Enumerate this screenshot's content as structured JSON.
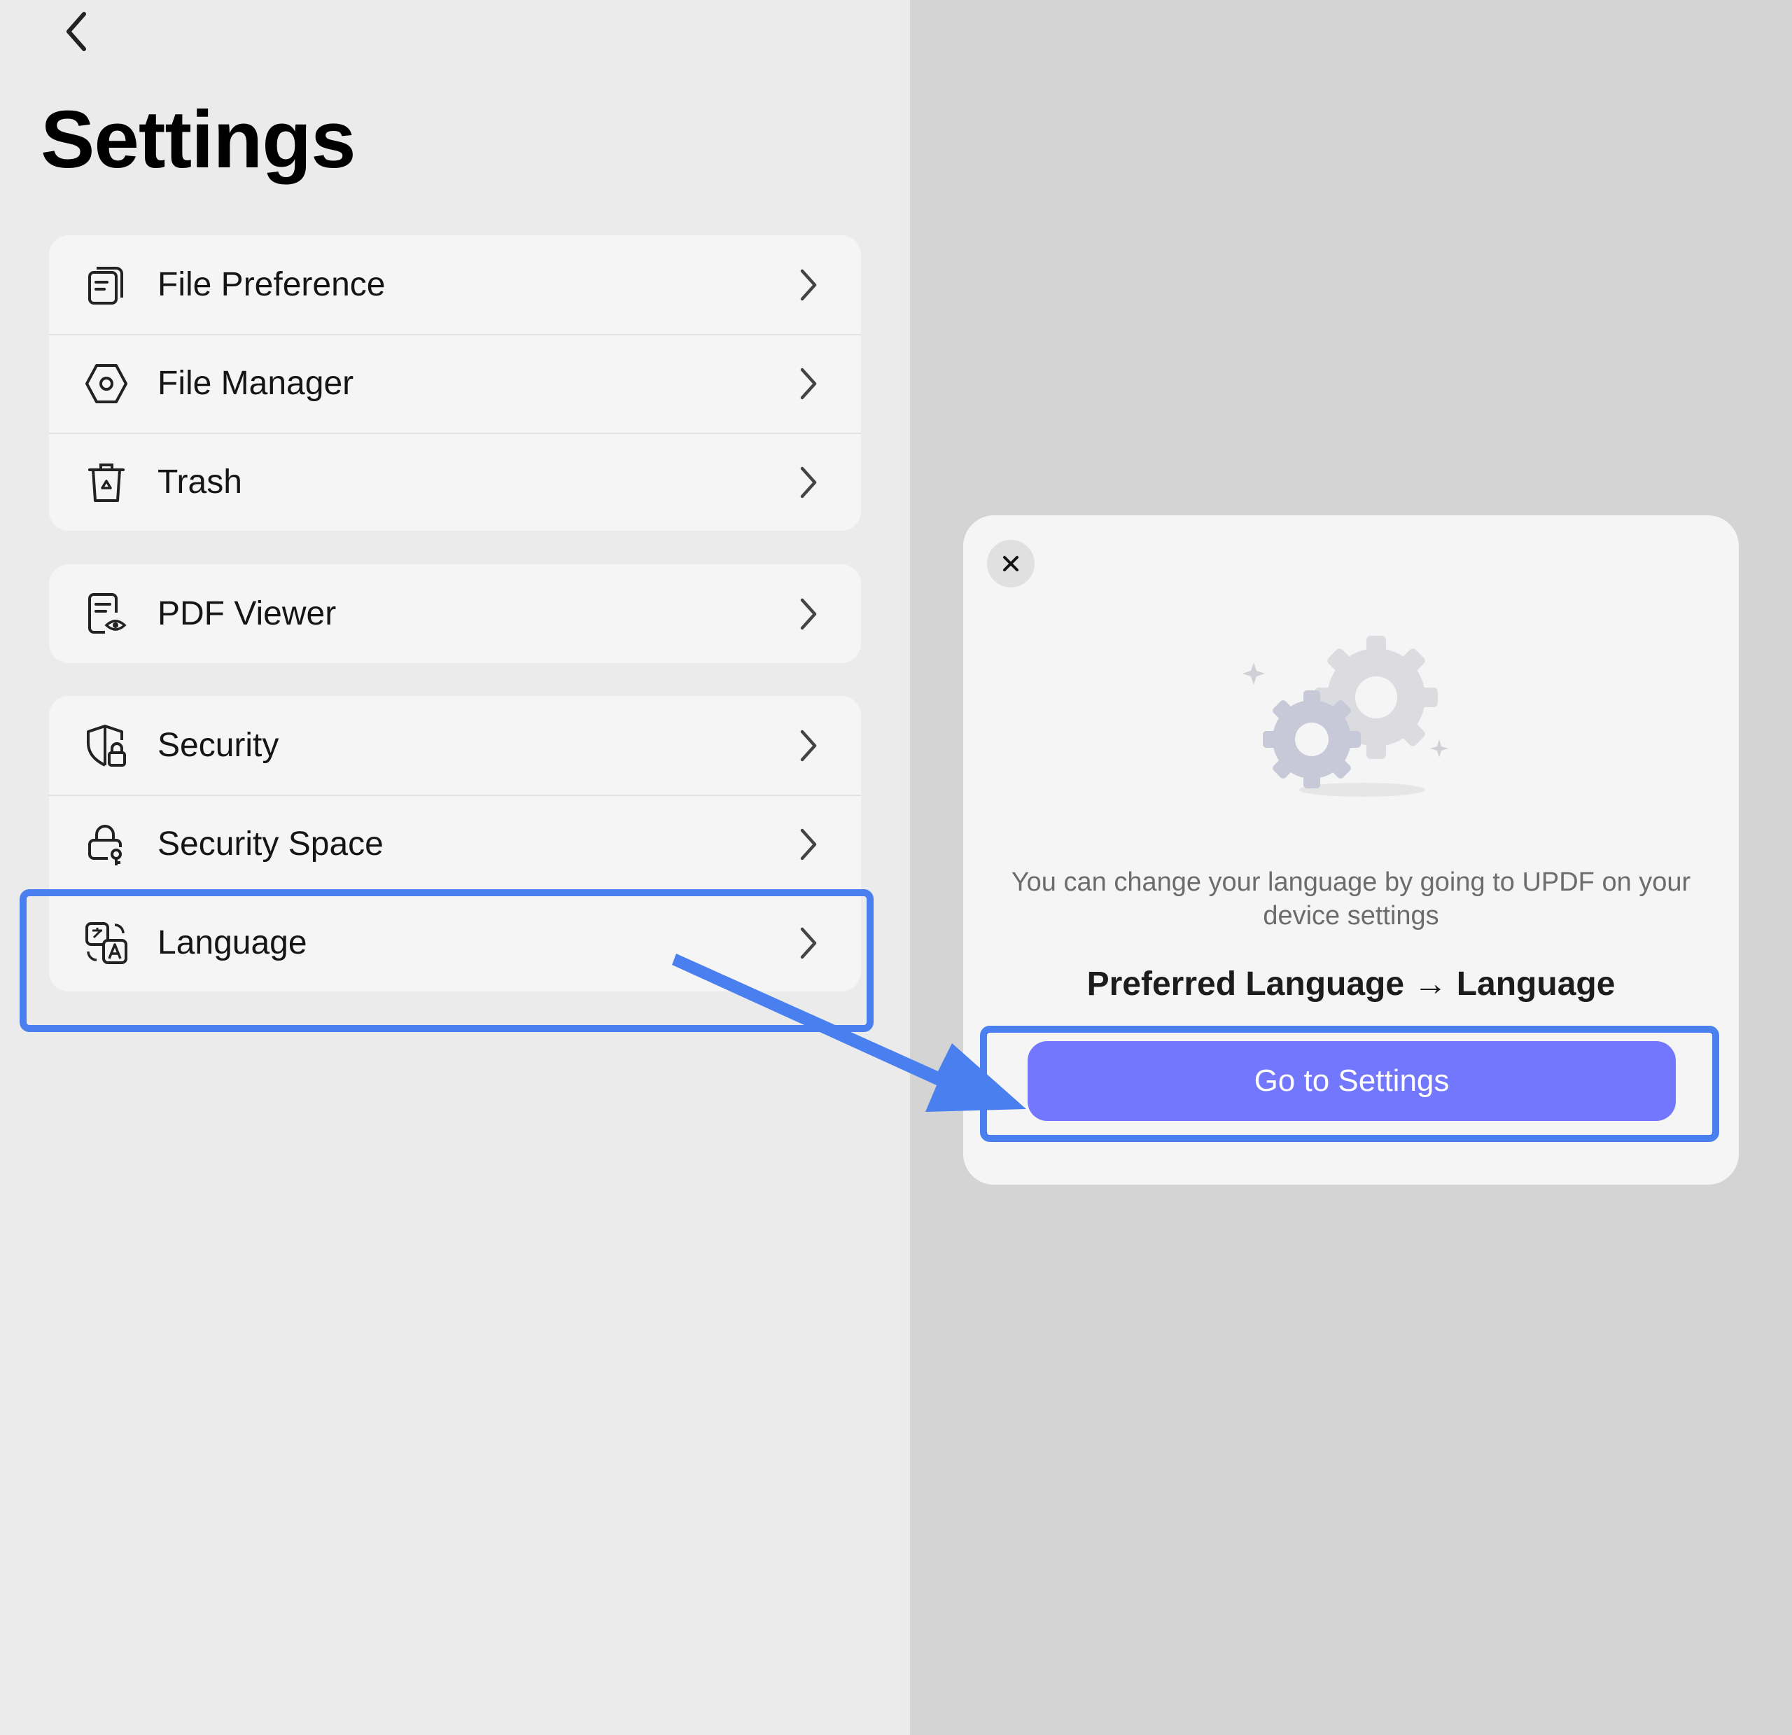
{
  "header": {
    "title": "Settings"
  },
  "groups": [
    {
      "items": [
        {
          "label": "File Preference",
          "icon": "file-preference-icon"
        },
        {
          "label": "File Manager",
          "icon": "file-manager-icon"
        },
        {
          "label": "Trash",
          "icon": "trash-icon"
        }
      ]
    },
    {
      "items": [
        {
          "label": "PDF Viewer",
          "icon": "pdf-viewer-icon"
        }
      ]
    },
    {
      "items": [
        {
          "label": "Security",
          "icon": "security-icon"
        },
        {
          "label": "Security Space",
          "icon": "security-space-icon"
        },
        {
          "label": "Language",
          "icon": "language-icon"
        }
      ]
    }
  ],
  "dialog": {
    "message": "You can change your language by going to UPDF on your device settings",
    "path": "Preferred Language → Language",
    "button_label": "Go to Settings"
  },
  "colors": {
    "accent": "#7277fd",
    "highlight": "#4a7ff0",
    "left_background": "#ebebeb",
    "right_background": "#d4d4d4",
    "card_background": "#f5f5f5"
  }
}
